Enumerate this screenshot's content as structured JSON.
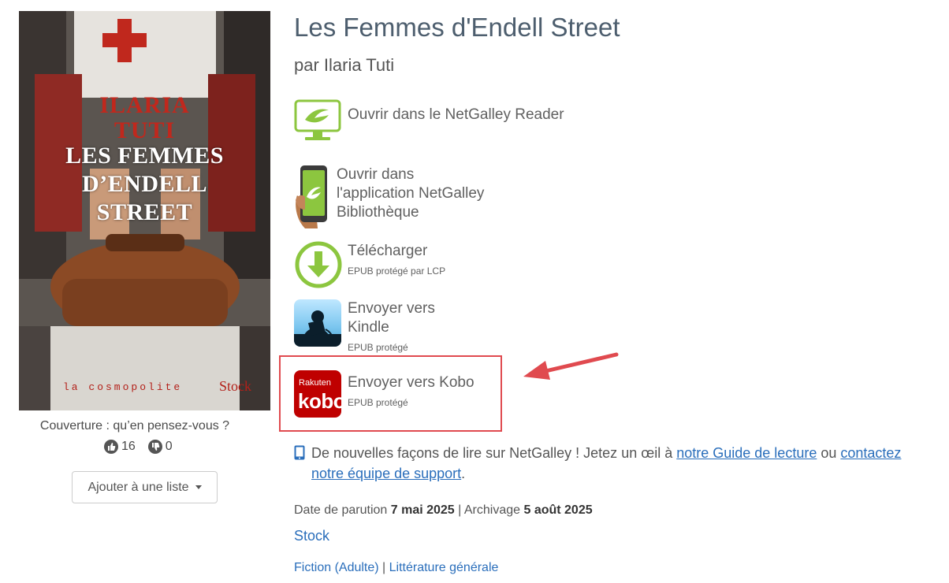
{
  "cover": {
    "author": "ILARIA\nTUTI",
    "title": "LES FEMMES\nD’ENDELL\nSTREET",
    "collection": "la cosmopolite",
    "publisher": "Stock",
    "feedback_prompt": "Couverture : qu’en pensez-vous ?",
    "likes": "16",
    "dislikes": "0",
    "add_to_list_label": "Ajouter à une liste"
  },
  "book": {
    "title": "Les Femmes d'Endell Street",
    "author": "par Ilaria Tuti"
  },
  "reading_options": {
    "reader": {
      "label": "Ouvrir dans le NetGalley Reader",
      "icon": "netgalley-reader-monitor-icon"
    },
    "app": {
      "label": "Ouvrir dans\nl'application NetGalley\nBibliothèque",
      "icon": "netgalley-app-phone-icon"
    },
    "download": {
      "label": "Télécharger",
      "sub": "EPUB protégé par LCP",
      "icon": "download-arrow-icon"
    },
    "kindle": {
      "label": "Envoyer vers\nKindle",
      "sub": "EPUB protégé",
      "icon": "kindle-reader-icon"
    },
    "kobo": {
      "label": "Envoyer vers Kobo",
      "sub": "EPUB protégé",
      "icon": "rakuten-kobo-icon",
      "kobo_brand": "Rakuten",
      "kobo_word": "kobo"
    }
  },
  "tip": {
    "text_before": "De nouvelles façons de lire sur NetGalley ! Jetez un œil à ",
    "guide_link": "notre Guide de lecture",
    "text_mid": " ou ",
    "contact_link": "contactez notre équipe de support",
    "text_after": "."
  },
  "dates": {
    "release_label": "Date de parution ",
    "release_date": "7 mai 2025",
    "separator": " | ",
    "archive_label": "Archivage ",
    "archive_date": "5 août 2025"
  },
  "publisher_link": "Stock",
  "categories": [
    "Fiction (Adulte)",
    "Littérature générale"
  ],
  "category_separator": " | ",
  "colors": {
    "netgalley_green": "#8cc63f",
    "link_blue": "#2a6ebb",
    "highlight_red": "#e04a4f",
    "kobo_red": "#bf0000"
  }
}
